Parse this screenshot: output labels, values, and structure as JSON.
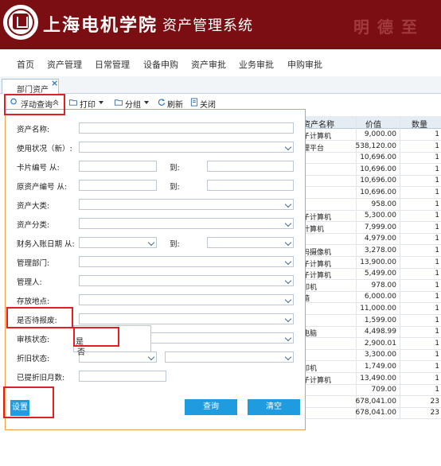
{
  "header": {
    "school_name": "上海电机学院",
    "system_name": "资产管理系统",
    "motto": "明德至"
  },
  "nav": {
    "items": [
      "首页",
      "资产管理",
      "日常管理",
      "设备申购",
      "资产审批",
      "业务审批",
      "申购审批"
    ]
  },
  "tab": {
    "label": "部门资产",
    "close": "×"
  },
  "toolbar": {
    "float_query": "浮动查询",
    "print": "打印",
    "group": "分组",
    "refresh": "刷新",
    "close": "关闭"
  },
  "grid": {
    "columns": [
      "资产名称",
      "价值",
      "数量"
    ],
    "rows": [
      {
        "name": "子计算机",
        "value": "9,000.00",
        "qty": "1"
      },
      {
        "name": "理平台",
        "value": "538,120.00",
        "qty": "1"
      },
      {
        "name": "",
        "value": "10,696.00",
        "qty": "1"
      },
      {
        "name": "",
        "value": "10,696.00",
        "qty": "1"
      },
      {
        "name": "",
        "value": "10,696.00",
        "qty": "1"
      },
      {
        "name": "",
        "value": "10,696.00",
        "qty": "1"
      },
      {
        "name": "",
        "value": "958.00",
        "qty": "1"
      },
      {
        "name": "子计算机",
        "value": "5,300.00",
        "qty": "1"
      },
      {
        "name": "计算机",
        "value": "7,999.00",
        "qty": "1"
      },
      {
        "name": "",
        "value": "4,979.00",
        "qty": "1"
      },
      {
        "name": "码摄像机",
        "value": "3,278.00",
        "qty": "1"
      },
      {
        "name": "子计算机",
        "value": "13,900.00",
        "qty": "1"
      },
      {
        "name": "子计算机",
        "value": "5,499.00",
        "qty": "1"
      },
      {
        "name": "印机",
        "value": "978.00",
        "qty": "1"
      },
      {
        "name": "箱",
        "value": "6,000.00",
        "qty": "1"
      },
      {
        "name": "",
        "value": "11,000.00",
        "qty": "1"
      },
      {
        "name": "",
        "value": "1,599.00",
        "qty": "1"
      },
      {
        "name": "电脑",
        "value": "4,498.99",
        "qty": "1"
      },
      {
        "name": "",
        "value": "2,900.01",
        "qty": "1"
      },
      {
        "name": "",
        "value": "3,300.00",
        "qty": "1"
      },
      {
        "name": "印机",
        "value": "1,749.00",
        "qty": "1"
      },
      {
        "name": "子计算机",
        "value": "13,490.00",
        "qty": "1"
      },
      {
        "name": "",
        "value": "709.00",
        "qty": "1"
      },
      {
        "name": "",
        "value": "678,041.00",
        "qty": "23"
      },
      {
        "name": "",
        "value": "678,041.00",
        "qty": "23"
      }
    ]
  },
  "form": {
    "asset_name": "资产名称:",
    "use_status": "使用状况（新）:",
    "card_no_from": "卡片编号 从:",
    "orig_asset_no_from": "原资产编号 从:",
    "to": "到:",
    "asset_major_class": "资产大类:",
    "asset_class": "资产分类:",
    "finance_date_from": "财务入账日期 从:",
    "manage_dept": "管理部门:",
    "manager": "管理人:",
    "location": "存放地点:",
    "pending_scrap": "是否待报废:",
    "audit_status": "审核状态:",
    "depreciation_status": "折旧状态:",
    "depreciated_months": "已提折旧月数:",
    "dropdown_options": [
      "是",
      "否"
    ],
    "settings_button": "设置",
    "query_button": "查询",
    "clear_button": "清空"
  },
  "colors": {
    "header_bg": "#7b0e12",
    "button_blue": "#1f9be0",
    "highlight_red": "#e02020",
    "panel_border": "#ee9a4a"
  }
}
